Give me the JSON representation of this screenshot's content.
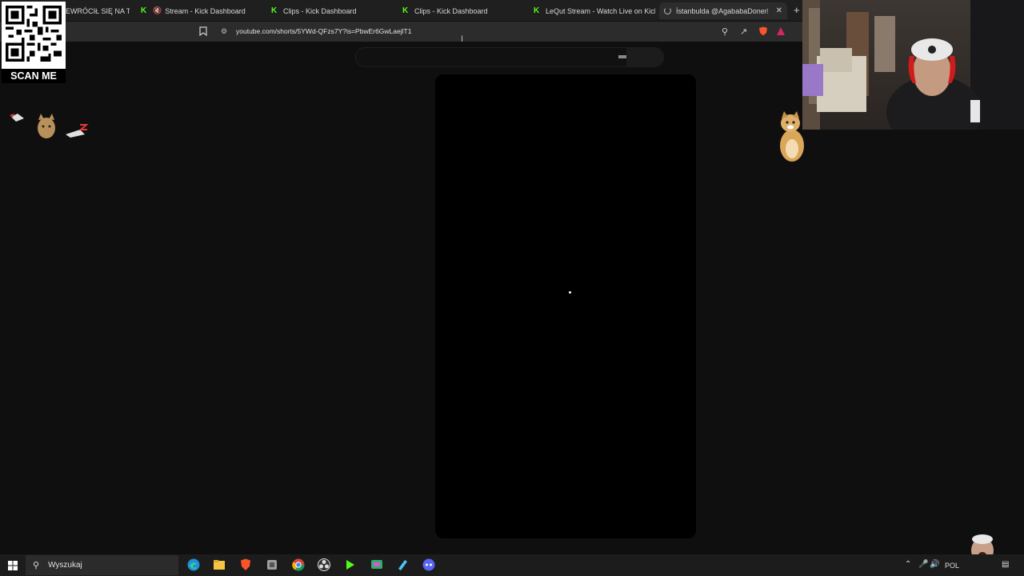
{
  "browser": {
    "tabs": [
      {
        "label": "EWRÓCIŁ SIĘ NA TOP",
        "icon": "partial-tab"
      },
      {
        "label": "Stream - Kick Dashboard",
        "icon": "kick-icon",
        "muted": true
      },
      {
        "label": "Clips - Kick Dashboard",
        "icon": "kick-icon"
      },
      {
        "label": "Clips - Kick Dashboard",
        "icon": "kick-icon"
      },
      {
        "label": "LeQut Stream - Watch Live on Kick",
        "icon": "kick-icon"
      },
      {
        "label": "İstanbulda @AgababaDonerResi",
        "icon": "loading-icon",
        "active": true
      }
    ],
    "new_tab_glyph": "+",
    "url": "youtube.com/shorts/5YWd-QFzs7Y?is=PbwEr6GwLaejlT1"
  },
  "overlay": {
    "qr_label": "SCAN ME"
  },
  "taskbar": {
    "search_placeholder": "Wyszukaj",
    "language": "POL",
    "apps": [
      "edge-icon",
      "file-explorer-icon",
      "brave-icon",
      "app-icon",
      "chrome-icon",
      "obs-icon",
      "kick-app-icon",
      "chat-app-icon",
      "notepad-icon",
      "discord-icon"
    ]
  },
  "colors": {
    "kick_green": "#53fc18",
    "page_background": "#0f0f0f",
    "player_background": "#000000"
  }
}
